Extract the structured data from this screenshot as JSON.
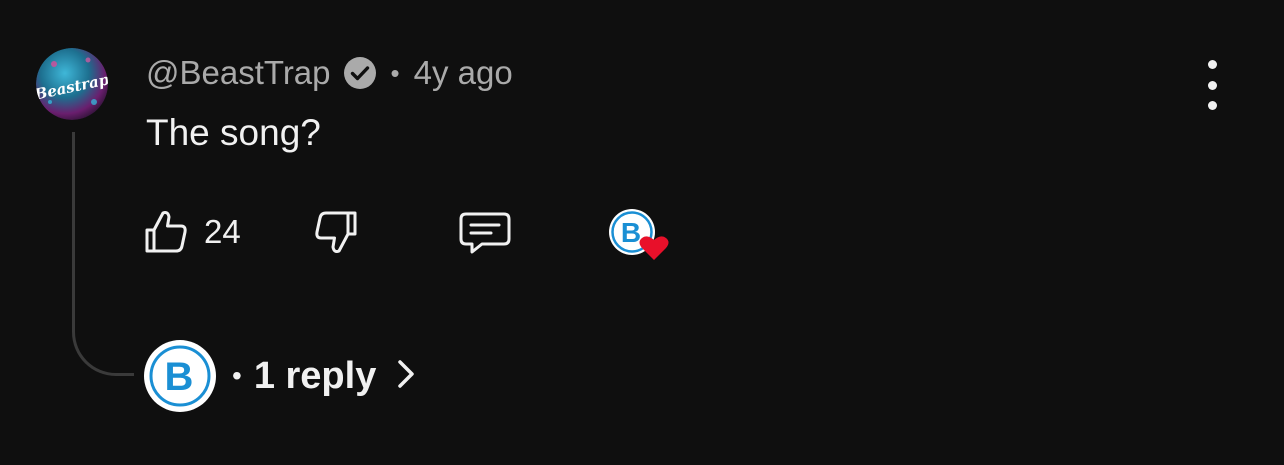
{
  "comment": {
    "author": "@BeastTrap",
    "verified": true,
    "separator": "•",
    "time": "4y ago",
    "text": "The song?",
    "avatar_text": "BeastTrap",
    "likes": "24"
  },
  "replies": {
    "bullet": "•",
    "label": "1 reply"
  },
  "hearted_by_creator": true,
  "icons": {
    "avatar": "beasttrap-avatar",
    "verified": "verified-check-icon",
    "menu": "more-vert-icon",
    "like": "thumbs-up-icon",
    "dislike": "thumbs-down-icon",
    "reply": "comment-reply-icon",
    "creator_heart": "creator-heart-badge",
    "chevron": "chevron-right-icon"
  },
  "colors": {
    "background": "#0f0f0f",
    "heart": "#e8102a",
    "creator_blue": "#1a8fd4",
    "muted_text": "#aaaaaa"
  }
}
